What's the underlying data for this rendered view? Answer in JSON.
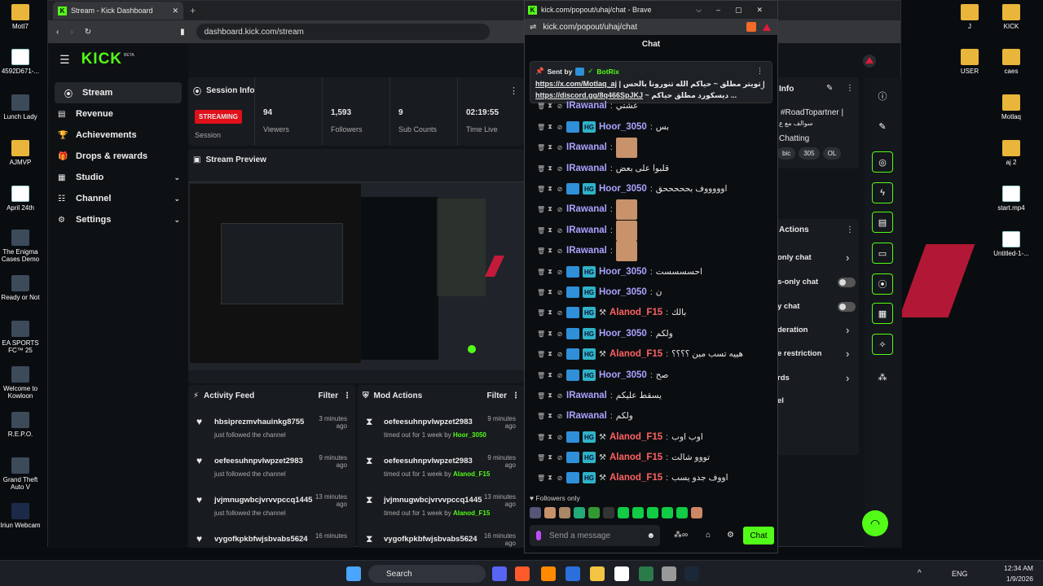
{
  "desktop_left": [
    {
      "label": "MotI7",
      "kind": "folder"
    },
    {
      "label": "4592D671-...",
      "kind": "file"
    },
    {
      "label": "Lunch Lady",
      "kind": "game"
    },
    {
      "label": "AJMVP",
      "kind": "folder"
    },
    {
      "label": "April 24th",
      "kind": "file"
    },
    {
      "label": "The Enigma Cases Demo",
      "kind": "game"
    },
    {
      "label": "Ready or Not",
      "kind": "game"
    },
    {
      "label": "EA SPORTS FC™ 25",
      "kind": "game"
    },
    {
      "label": "Welcome to Kowloon",
      "kind": "game"
    },
    {
      "label": "R.E.P.O.",
      "kind": "game"
    },
    {
      "label": "Grand Theft Auto V",
      "kind": "game"
    },
    {
      "label": "Iriun Webcam",
      "kind": "app"
    }
  ],
  "desktop_right": [
    {
      "label": "J",
      "kind": "folder"
    },
    {
      "label": "KICK",
      "kind": "folder"
    },
    {
      "label": "USER",
      "kind": "folder"
    },
    {
      "label": "caes",
      "kind": "folder"
    },
    {
      "label": "Motlaq",
      "kind": "folder"
    },
    {
      "label": "aj 2",
      "kind": "folder"
    },
    {
      "label": "start.mp4",
      "kind": "file"
    },
    {
      "label": "Untitled-1-...",
      "kind": "file"
    }
  ],
  "browser": {
    "tab_title": "Stream - Kick Dashboard",
    "url": "dashboard.kick.com/stream"
  },
  "logo": "KICK",
  "logo_beta": "BETA",
  "sidebar": [
    {
      "label": "Stream",
      "icon": "broadcast-icon"
    },
    {
      "label": "Revenue",
      "icon": "revenue-icon"
    },
    {
      "label": "Achievements",
      "icon": "trophy-icon"
    },
    {
      "label": "Drops & rewards",
      "icon": "gift-icon"
    },
    {
      "label": "Studio",
      "icon": "studio-icon",
      "chev": "⌄"
    },
    {
      "label": "Channel",
      "icon": "channel-icon",
      "chev": "⌄"
    },
    {
      "label": "Settings",
      "icon": "gear-icon",
      "chev": "⌄"
    }
  ],
  "session": {
    "title": "Session Info",
    "badge": "STREAMING",
    "badge_label": "Session",
    "stats": [
      {
        "value": "94",
        "label": "Viewers"
      },
      {
        "value": "1,593",
        "label": "Followers"
      },
      {
        "value": "9",
        "label": "Sub Counts"
      },
      {
        "value": "02:19:55",
        "label": "Time Live"
      }
    ]
  },
  "preview_title": "Stream Preview",
  "activity": {
    "title": "Activity Feed",
    "filter": "Filter",
    "items": [
      {
        "name": "hbsiprezmvhauinkg8755",
        "sub": "just followed the channel",
        "time": "3 minutes ago"
      },
      {
        "name": "oefeesuhnpvlwpzet2983",
        "sub": "just followed the channel",
        "time": "9 minutes ago"
      },
      {
        "name": "jvjmnugwbcjvrvvpccq1445",
        "sub": "just followed the channel",
        "time": "13 minutes ago"
      },
      {
        "name": "vygofkpkbfwjsbvabs5624",
        "sub": "",
        "time": "16 minutes"
      }
    ]
  },
  "mod": {
    "title": "Mod Actions",
    "filter": "Filter",
    "items": [
      {
        "name": "oefeesuhnpvlwpzet2983",
        "sub": "timed out for 1 week by ",
        "by": "Hoor_3050",
        "time": "9 minutes ago"
      },
      {
        "name": "oefeesuhnpvlwpzet2983",
        "sub": "timed out for 1 week by ",
        "by": "Alanod_F15",
        "time": "9 minutes ago"
      },
      {
        "name": "jvjmnugwbcjvrvvpccq1445",
        "sub": "timed out for 1 week by ",
        "by": "Alanod_F15",
        "time": "13 minutes ago"
      },
      {
        "name": "vygofkpkbfwjsbvabs5624",
        "sub": "",
        "by": "",
        "time": "16 minutes ago"
      }
    ]
  },
  "right_panel": {
    "info": "Info",
    "tag": "#RoadTopartner |",
    "tag2": "سوالف مع ع",
    "chatting": "Chatting",
    "chips": [
      "bic",
      "305",
      "OL"
    ],
    "actions_title": "Actions",
    "actions": [
      "only chat",
      "s-only chat",
      "y chat",
      "deration",
      "e restriction",
      "rds",
      "el"
    ]
  },
  "chat": {
    "window_title": "kick.com/popout/uhaj/chat - Brave",
    "url": "kick.com/popout/uhaj/chat",
    "header": "Chat",
    "pinned": {
      "sent_by": "Sent by",
      "bot": "BotRix",
      "line1": "https://x.com/Motlaq_aj",
      "line1b": "| تويتر مطلق ~ حياكم الله تنورونا بالحس |",
      "line2": "https://discord.gg/8q466SpJKJ",
      "line2b": "~ ديسكورد مطلق حياكم ..."
    },
    "messages": [
      {
        "user": "IRawanal",
        "color": "#a9a3ff",
        "text": "عشتي",
        "badges": 0,
        "emote": false
      },
      {
        "user": "Hoor_3050",
        "color": "#a9a3ff",
        "text": "بس",
        "badges": 2,
        "emote": false
      },
      {
        "user": "IRawanal",
        "color": "#a9a3ff",
        "text": "",
        "badges": 0,
        "emote": true
      },
      {
        "user": "IRawanal",
        "color": "#a9a3ff",
        "text": "قلبوا على بعض",
        "badges": 0,
        "emote": false
      },
      {
        "user": "Hoor_3050",
        "color": "#a9a3ff",
        "text": "اوووووف بحححححق",
        "badges": 2,
        "emote": false
      },
      {
        "user": "IRawanal",
        "color": "#a9a3ff",
        "text": "",
        "badges": 0,
        "emote": true
      },
      {
        "user": "IRawanal",
        "color": "#a9a3ff",
        "text": "",
        "badges": 0,
        "emote": true
      },
      {
        "user": "IRawanal",
        "color": "#a9a3ff",
        "text": "",
        "badges": 0,
        "emote": true
      },
      {
        "user": "Hoor_3050",
        "color": "#a9a3ff",
        "text": "احسسسست",
        "badges": 2,
        "emote": false
      },
      {
        "user": "Hoor_3050",
        "color": "#a9a3ff",
        "text": "ن",
        "badges": 2,
        "emote": false
      },
      {
        "user": "Alanod_F15",
        "color": "#ff6161",
        "text": "بالك",
        "badges": 3,
        "emote": false
      },
      {
        "user": "Hoor_3050",
        "color": "#a9a3ff",
        "text": "ولكم",
        "badges": 2,
        "emote": false
      },
      {
        "user": "Alanod_F15",
        "color": "#ff6161",
        "text": "هييه تسب مين ؟؟؟؟",
        "badges": 3,
        "emote": false
      },
      {
        "user": "Hoor_3050",
        "color": "#a9a3ff",
        "text": "صح",
        "badges": 2,
        "emote": false
      },
      {
        "user": "IRawanal",
        "color": "#a9a3ff",
        "text": "يسقط عليكم",
        "badges": 0,
        "emote": false
      },
      {
        "user": "IRawanal",
        "color": "#a9a3ff",
        "text": "ولكم",
        "badges": 0,
        "emote": false
      },
      {
        "user": "Alanod_F15",
        "color": "#ff6161",
        "text": "اوب اوب",
        "badges": 3,
        "emote": false
      },
      {
        "user": "Alanod_F15",
        "color": "#ff6161",
        "text": "تووو شالت",
        "badges": 3,
        "emote": false
      },
      {
        "user": "Alanod_F15",
        "color": "#ff6161",
        "text": "اووف جدو يسب",
        "badges": 3,
        "emote": false
      }
    ],
    "followers_only": "Followers only",
    "placeholder": "Send a message",
    "send": "Chat"
  },
  "taskbar": {
    "search": "Search",
    "lang": "ENG",
    "time": "12:34 AM",
    "date": "1/9/2026"
  }
}
